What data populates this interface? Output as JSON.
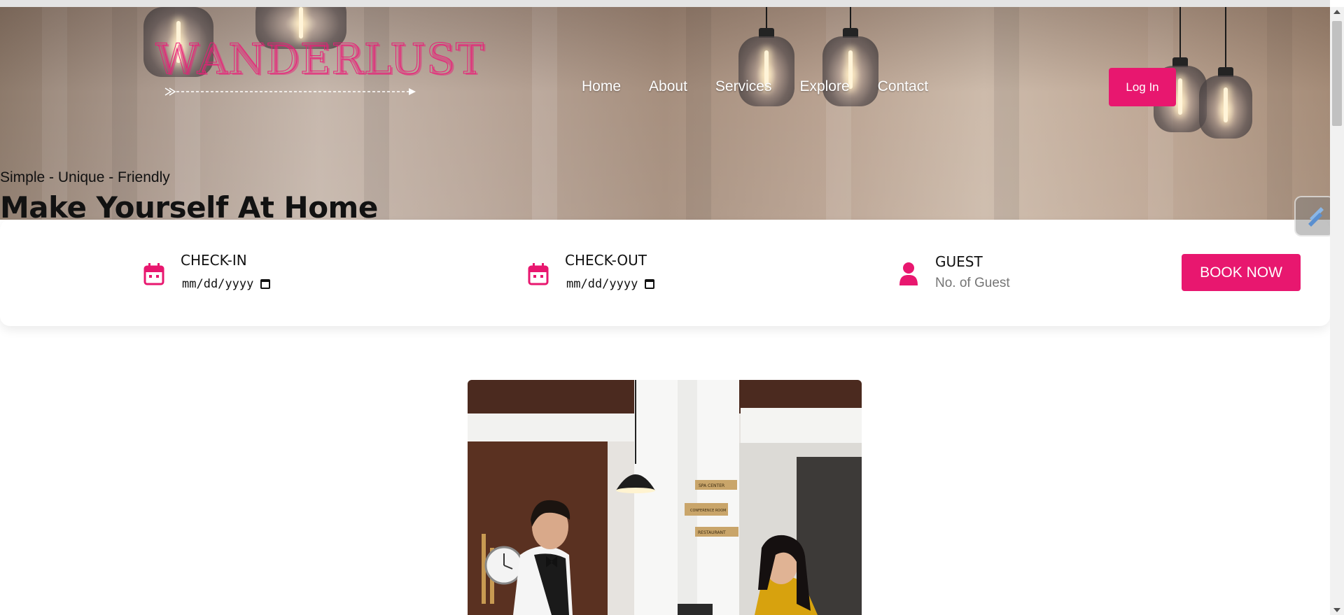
{
  "brand": {
    "logo_text": "WANDERLUST",
    "accent_color": "#e8176f"
  },
  "nav": {
    "items": [
      "Home",
      "About",
      "Services",
      "Explore",
      "Contact"
    ],
    "login_label": "Log In"
  },
  "hero": {
    "tagline": "Simple - Unique - Friendly",
    "headline": "Make Yourself At Home"
  },
  "booking": {
    "checkin_label": "CHECK-IN",
    "checkin_value": "mm/dd/yyyy",
    "checkout_label": "CHECK-OUT",
    "checkout_value": "mm/dd/yyyy",
    "guest_label": "GUEST",
    "guest_placeholder": "No. of Guest",
    "book_label": "BOOK NOW"
  },
  "photo": {
    "signs": [
      "SPA CENTER",
      "CONFERENCE ROOM",
      "RESTAURANT"
    ]
  },
  "icons": {
    "calendar": "calendar-icon",
    "person": "person-icon"
  }
}
